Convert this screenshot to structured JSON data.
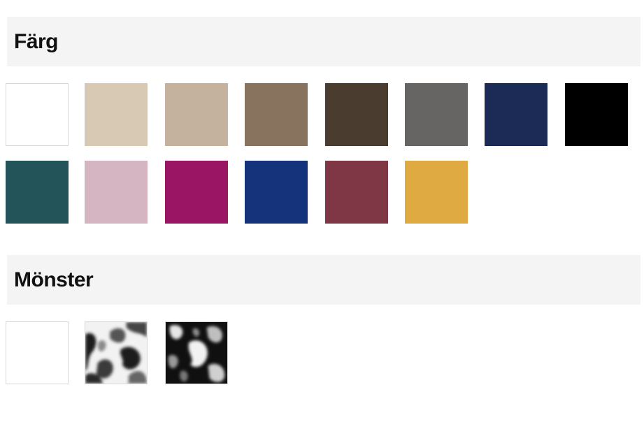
{
  "filters": {
    "color": {
      "title": "Färg",
      "swatches": [
        {
          "name": "white",
          "hex": "#ffffff"
        },
        {
          "name": "light-beige",
          "hex": "#d7c9b4"
        },
        {
          "name": "beige",
          "hex": "#c4b29f"
        },
        {
          "name": "brown",
          "hex": "#88735f"
        },
        {
          "name": "dark-brown",
          "hex": "#4b3c30"
        },
        {
          "name": "grey",
          "hex": "#676563"
        },
        {
          "name": "navy",
          "hex": "#1b2b55"
        },
        {
          "name": "black",
          "hex": "#000000"
        },
        {
          "name": "dark-teal",
          "hex": "#22545a"
        },
        {
          "name": "pink",
          "hex": "#d4b5c1"
        },
        {
          "name": "magenta",
          "hex": "#9a1665"
        },
        {
          "name": "blue",
          "hex": "#15337a"
        },
        {
          "name": "burgundy",
          "hex": "#7f3745"
        },
        {
          "name": "yellow",
          "hex": "#e0aa42"
        }
      ]
    },
    "pattern": {
      "title": "Mönster",
      "swatches": [
        {
          "name": "plain",
          "hex": "#ffffff"
        },
        {
          "name": "pattern-light",
          "hex": "#ffffff"
        },
        {
          "name": "pattern-dark",
          "hex": "#111111"
        }
      ]
    }
  }
}
